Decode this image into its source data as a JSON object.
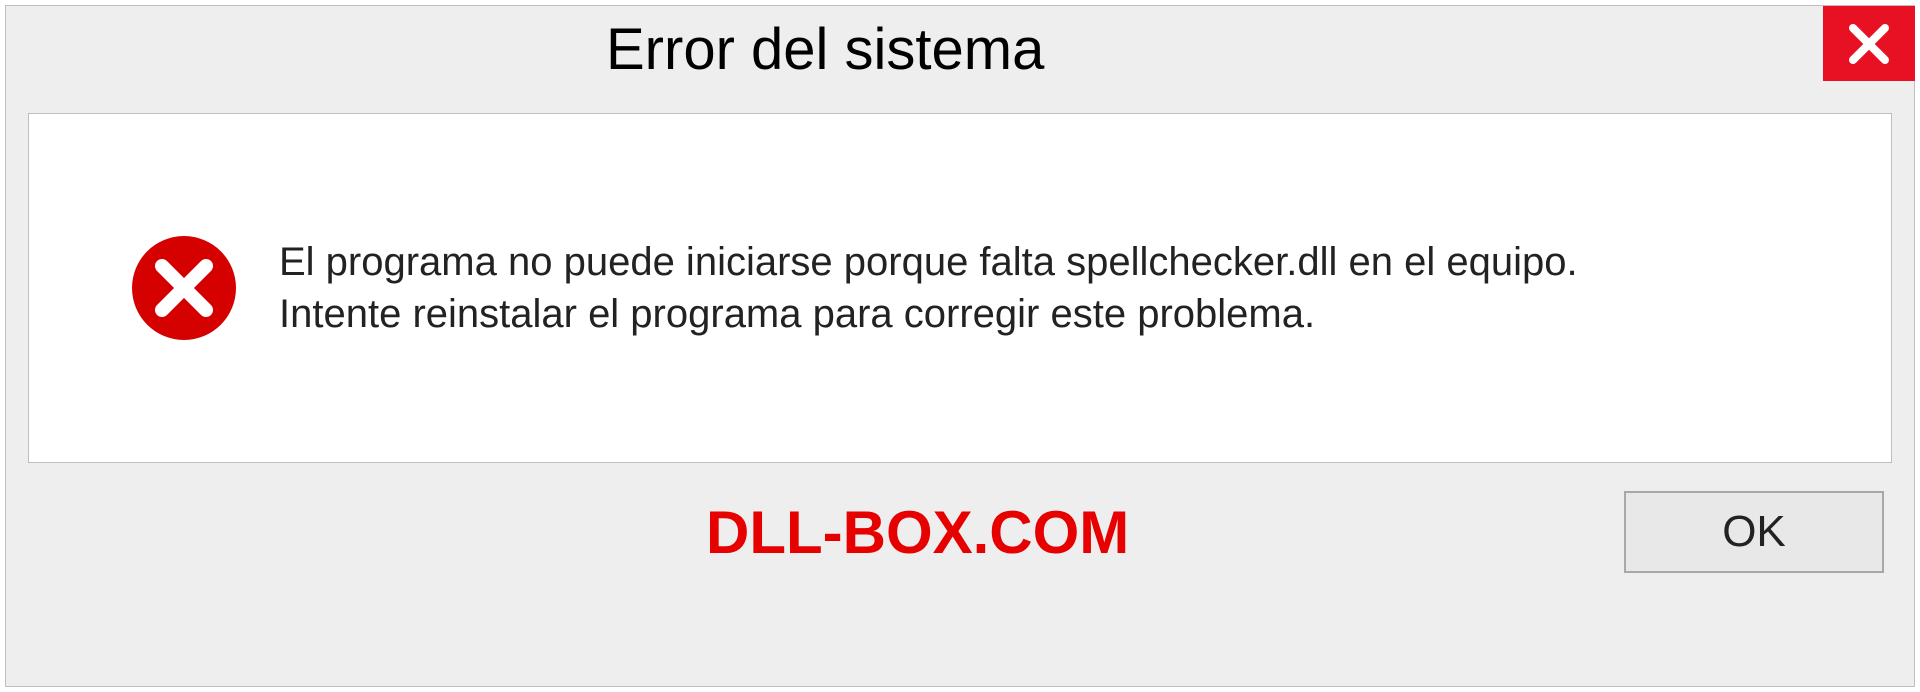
{
  "dialog": {
    "title": "Error del sistema",
    "message_line1": "El programa no puede iniciarse porque falta spellchecker.dll en el equipo.",
    "message_line2": "Intente reinstalar el programa para corregir este problema.",
    "ok_label": "OK"
  },
  "brand": {
    "text": "DLL-BOX.COM"
  },
  "colors": {
    "close_red": "#e81123",
    "error_red": "#d50000",
    "brand_red": "#e60000"
  }
}
